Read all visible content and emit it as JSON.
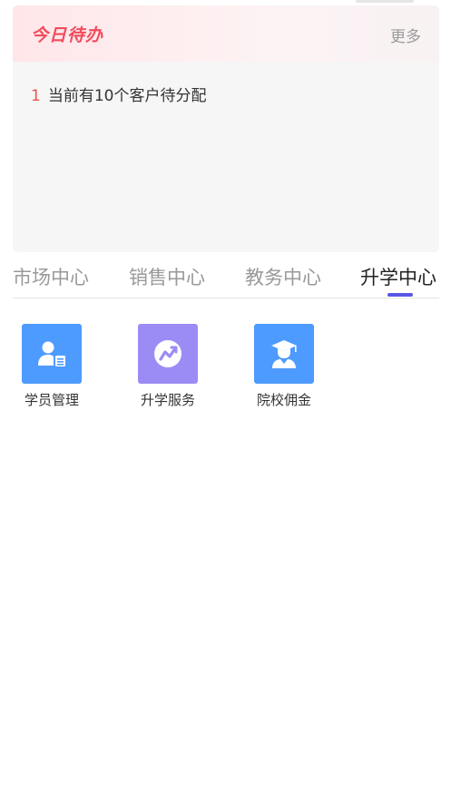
{
  "todo": {
    "title": "今日待办",
    "more_label": "更多",
    "items": [
      {
        "index": "1",
        "text": "当前有10个客户待分配"
      }
    ]
  },
  "tabs": [
    {
      "label": "市场中心",
      "active": false
    },
    {
      "label": "销售中心",
      "active": false
    },
    {
      "label": "教务中心",
      "active": false
    },
    {
      "label": "升学中心",
      "active": true
    }
  ],
  "grid": [
    {
      "label": "学员管理",
      "icon": "student-card-icon",
      "color": "#4e9bff"
    },
    {
      "label": "升学服务",
      "icon": "trend-up-icon",
      "color": "#9b8cf5"
    },
    {
      "label": "院校佣金",
      "icon": "graduate-icon",
      "color": "#4e9bff"
    }
  ],
  "colors": {
    "todo_title": "#f24b5c",
    "tab_indicator": "#5a57e6"
  }
}
